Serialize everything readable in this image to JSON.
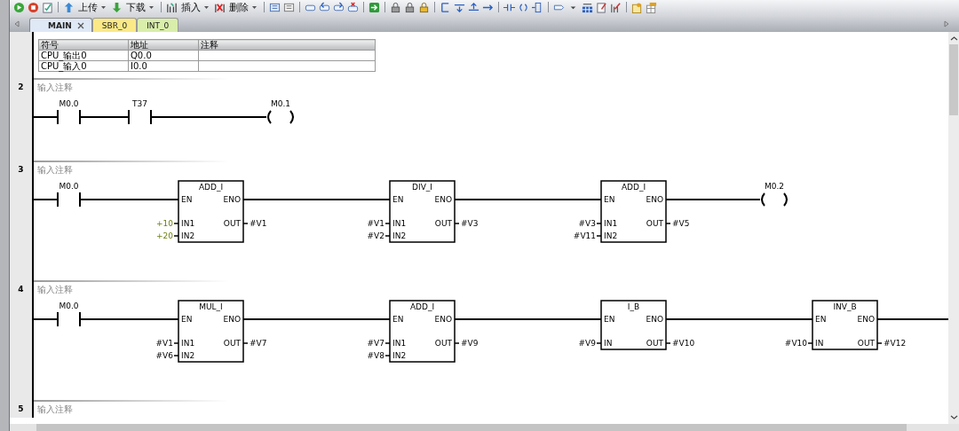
{
  "toolbar": {
    "buttons": [
      {
        "label": "上传"
      },
      {
        "label": "下载"
      },
      {
        "label": "插入"
      },
      {
        "label": "删除"
      }
    ]
  },
  "tabs": [
    {
      "label": "MAIN",
      "selected": true,
      "color": "#dfe8f5"
    },
    {
      "label": "SBR_0",
      "selected": false,
      "color": "#fbe987"
    },
    {
      "label": "INT_0",
      "selected": false,
      "color": "#d9eeaa"
    }
  ],
  "networks": [
    {
      "symbol_table": {
        "columns": [
          "符号",
          "地址",
          "注释"
        ],
        "rows": [
          [
            "CPU_输出0",
            "Q0.0",
            ""
          ],
          [
            "CPU_输入0",
            "I0.0",
            ""
          ]
        ]
      }
    },
    {
      "number": "2",
      "comment": "输入注释",
      "rung": [
        {
          "kind": "contact",
          "operand": "M0.0"
        },
        {
          "kind": "contact",
          "operand": "T37"
        },
        {
          "kind": "coil",
          "operand": "M0.1"
        }
      ]
    },
    {
      "number": "3",
      "comment": "输入注释",
      "rung": [
        {
          "kind": "contact",
          "operand": "M0.0"
        },
        {
          "kind": "box",
          "name": "ADD_I",
          "en": "EN",
          "eno": "ENO",
          "inputs": [
            {
              "pin": "IN1",
              "operand": "+10",
              "constant": true
            },
            {
              "pin": "IN2",
              "operand": "+20",
              "constant": true
            }
          ],
          "outputs": [
            {
              "pin": "OUT",
              "operand": "#V1"
            }
          ]
        },
        {
          "kind": "box",
          "name": "DIV_I",
          "en": "EN",
          "eno": "ENO",
          "inputs": [
            {
              "pin": "IN1",
              "operand": "#V1",
              "constant": false
            },
            {
              "pin": "IN2",
              "operand": "#V2",
              "constant": false
            }
          ],
          "outputs": [
            {
              "pin": "OUT",
              "operand": "#V3"
            }
          ]
        },
        {
          "kind": "box",
          "name": "ADD_I",
          "en": "EN",
          "eno": "ENO",
          "inputs": [
            {
              "pin": "IN1",
              "operand": "#V3",
              "constant": false
            },
            {
              "pin": "IN2",
              "operand": "#V11",
              "constant": false
            }
          ],
          "outputs": [
            {
              "pin": "OUT",
              "operand": "#V5"
            }
          ]
        },
        {
          "kind": "coil",
          "operand": "M0.2"
        }
      ]
    },
    {
      "number": "4",
      "comment": "输入注释",
      "rung": [
        {
          "kind": "contact",
          "operand": "M0.0"
        },
        {
          "kind": "box",
          "name": "MUL_I",
          "en": "EN",
          "eno": "ENO",
          "inputs": [
            {
              "pin": "IN1",
              "operand": "#V1",
              "constant": false
            },
            {
              "pin": "IN2",
              "operand": "#V6",
              "constant": false
            }
          ],
          "outputs": [
            {
              "pin": "OUT",
              "operand": "#V7"
            }
          ]
        },
        {
          "kind": "box",
          "name": "ADD_I",
          "en": "EN",
          "eno": "ENO",
          "inputs": [
            {
              "pin": "IN1",
              "operand": "#V7",
              "constant": false
            },
            {
              "pin": "IN2",
              "operand": "#V8",
              "constant": false
            }
          ],
          "outputs": [
            {
              "pin": "OUT",
              "operand": "#V9"
            }
          ]
        },
        {
          "kind": "box",
          "name": "I_B",
          "en": "EN",
          "eno": "ENO",
          "inputs": [
            {
              "pin": "IN",
              "operand": "#V9",
              "constant": false
            }
          ],
          "outputs": [
            {
              "pin": "OUT",
              "operand": "#V10"
            }
          ]
        },
        {
          "kind": "box",
          "name": "INV_B",
          "en": "EN",
          "eno": "ENO",
          "inputs": [
            {
              "pin": "IN",
              "operand": "#V10",
              "constant": false
            }
          ],
          "outputs": [
            {
              "pin": "OUT",
              "operand": "#V12"
            }
          ]
        }
      ]
    },
    {
      "number": "5",
      "comment": "输入注释"
    }
  ]
}
